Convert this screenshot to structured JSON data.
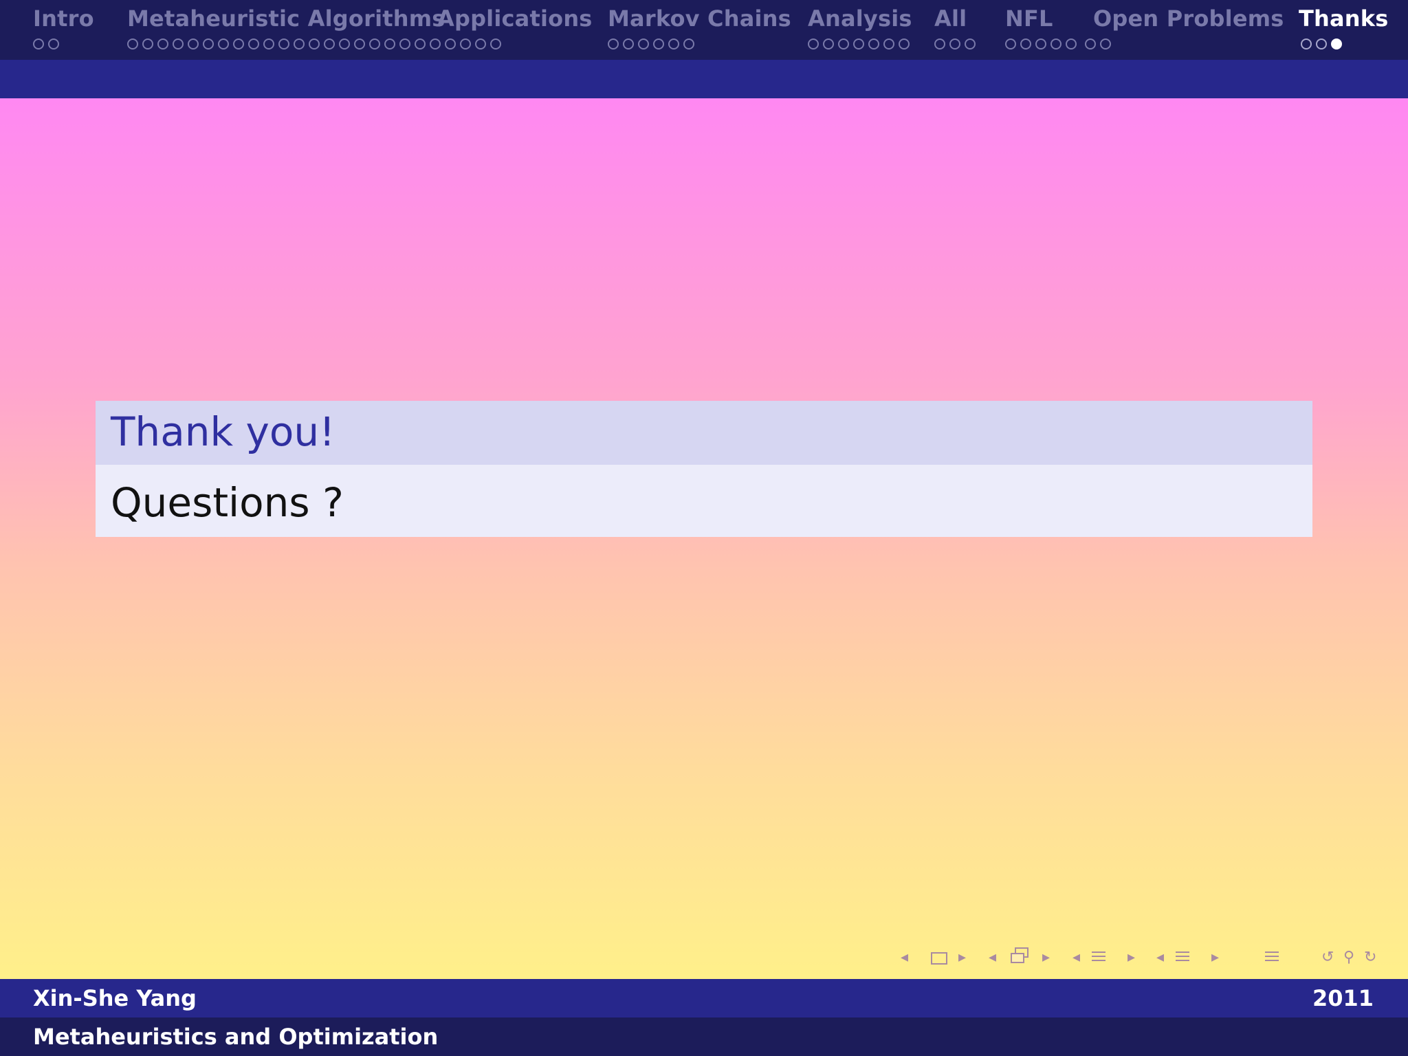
{
  "nav": {
    "sections": [
      {
        "title": "Intro",
        "dots": 2,
        "filled": -1,
        "current": false
      },
      {
        "title": "Metaheuristic Algorithms",
        "dots": 25,
        "filled": -1,
        "current": false
      },
      {
        "title": "Applications",
        "dots": 0,
        "filled": -1,
        "current": false
      },
      {
        "title": "Markov Chains",
        "dots": 6,
        "filled": -1,
        "current": false
      },
      {
        "title": "Analysis",
        "dots": 7,
        "filled": -1,
        "current": false
      },
      {
        "title": "All",
        "dots": 3,
        "filled": -1,
        "current": false
      },
      {
        "title": "NFL",
        "dots": 7,
        "filled": -1,
        "current": false
      },
      {
        "title": "Open Problems",
        "dots": 0,
        "filled": -1,
        "current": false
      },
      {
        "title": "Thanks",
        "dots": 3,
        "filled": 2,
        "current": true
      }
    ]
  },
  "block": {
    "title": "Thank you!",
    "body": "Questions ?"
  },
  "nav_icons": [
    "prev-slide-icon",
    "slide-icon",
    "next-slide-icon",
    "prev-frame-icon",
    "frame-icon",
    "next-frame-icon",
    "prev-subsection-icon",
    "subsection-icon",
    "next-subsection-icon",
    "prev-section-icon",
    "section-icon",
    "next-section-icon",
    "document-icon",
    "undo-icon",
    "search-icon",
    "redo-icon"
  ],
  "footer": {
    "author": "Xin-She Yang",
    "year": "2011",
    "title": "Metaheuristics and Optimization"
  },
  "colors": {
    "nav_bg": "#1c1c5a",
    "nav_bg2": "#27278c",
    "block_title_bg": "#d6d6f2",
    "block_body_bg": "#ececfa",
    "block_title_text": "#2f2fa0"
  }
}
